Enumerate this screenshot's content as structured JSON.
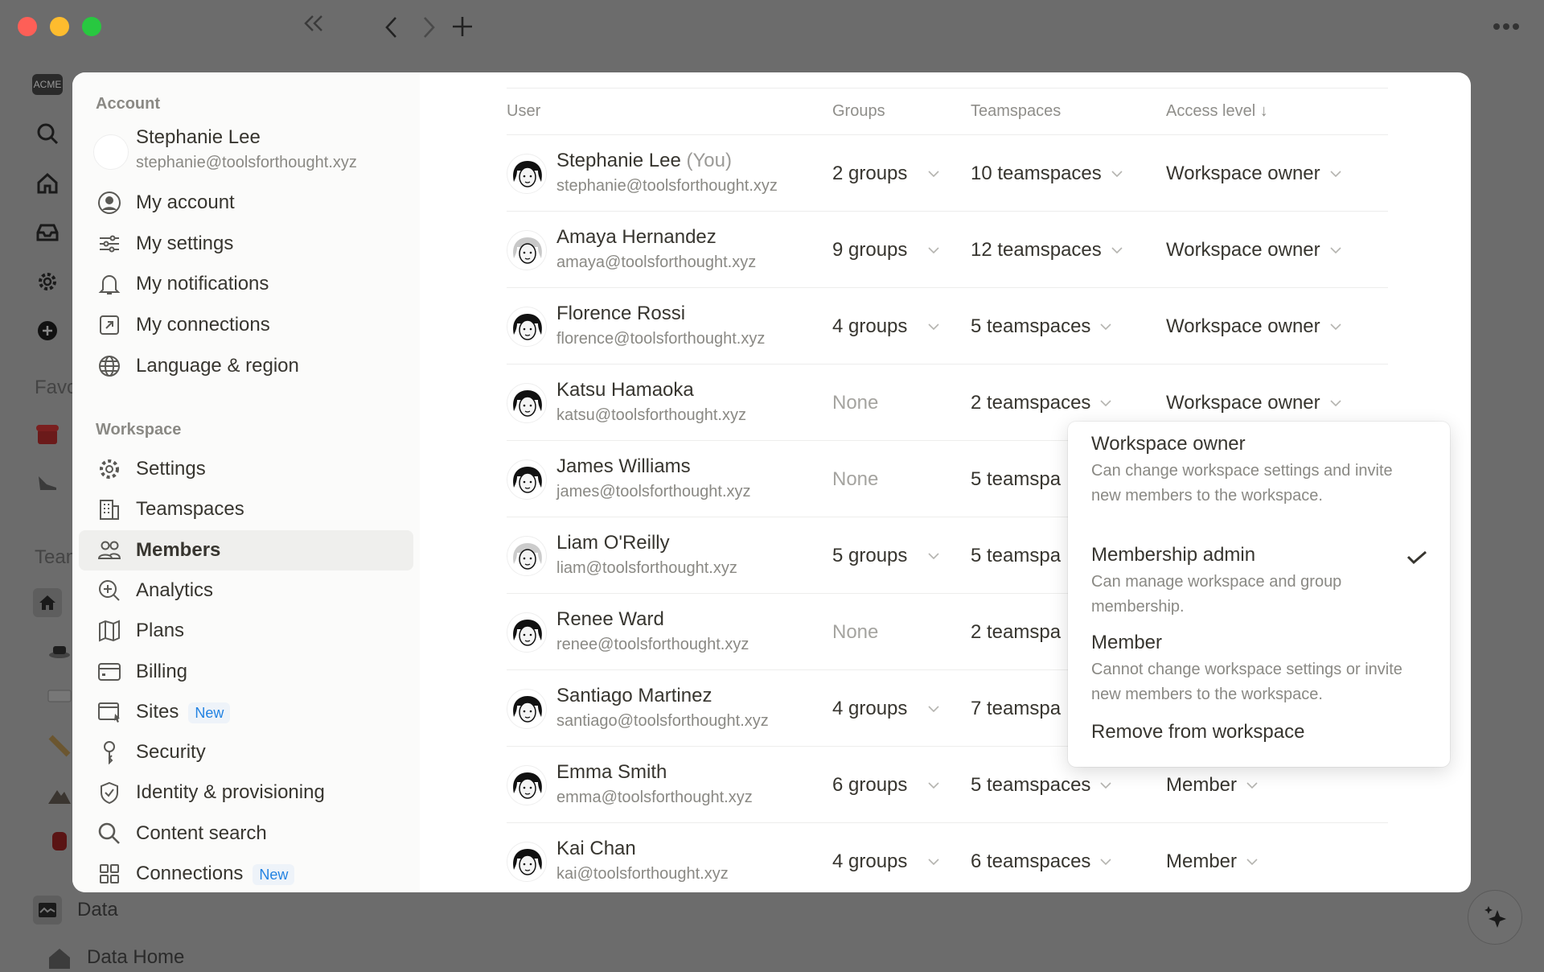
{
  "titlebar": {
    "colors": {
      "close": "#fe5f57",
      "minimize": "#febc2e",
      "zoom": "#28c840"
    }
  },
  "background": {
    "logo": "ACME",
    "favorites_label": "Favo",
    "teamspaces_label": "Tean",
    "data_label": "Data",
    "data_home_label": "Data Home"
  },
  "sidebar": {
    "account_label": "Account",
    "user": {
      "name": "Stephanie Lee",
      "email": "stephanie@toolsforthought.xyz"
    },
    "account_items": [
      {
        "label": "My account",
        "icon": "user-circle-icon"
      },
      {
        "label": "My settings",
        "icon": "sliders-icon"
      },
      {
        "label": "My notifications",
        "icon": "bell-icon"
      },
      {
        "label": "My connections",
        "icon": "external-link-icon"
      },
      {
        "label": "Language & region",
        "icon": "globe-icon"
      }
    ],
    "workspace_label": "Workspace",
    "workspace_items": [
      {
        "label": "Settings",
        "icon": "gear-icon"
      },
      {
        "label": "Teamspaces",
        "icon": "building-icon"
      },
      {
        "label": "Members",
        "icon": "people-icon",
        "active": true
      },
      {
        "label": "Analytics",
        "icon": "analytics-search-icon"
      },
      {
        "label": "Plans",
        "icon": "map-icon"
      },
      {
        "label": "Billing",
        "icon": "credit-card-icon"
      },
      {
        "label": "Sites",
        "icon": "browser-cursor-icon",
        "badge": "New"
      },
      {
        "label": "Security",
        "icon": "key-icon"
      },
      {
        "label": "Identity & provisioning",
        "icon": "shield-check-icon"
      },
      {
        "label": "Content search",
        "icon": "search-icon"
      },
      {
        "label": "Connections",
        "icon": "grid-icon",
        "badge": "New"
      }
    ]
  },
  "table": {
    "headers": {
      "user": "User",
      "groups": "Groups",
      "teamspaces": "Teamspaces",
      "access": "Access level ↓"
    },
    "rows": [
      {
        "name": "Stephanie Lee",
        "you": "(You)",
        "email": "stephanie@toolsforthought.xyz",
        "groups": "2 groups",
        "teamspaces": "10 teamspaces",
        "access": "Workspace owner"
      },
      {
        "name": "Amaya Hernandez",
        "email": "amaya@toolsforthought.xyz",
        "groups": "9 groups",
        "teamspaces": "12 teamspaces",
        "access": "Workspace owner"
      },
      {
        "name": "Florence Rossi",
        "email": "florence@toolsforthought.xyz",
        "groups": "4 groups",
        "teamspaces": "5 teamspaces",
        "access": "Workspace owner"
      },
      {
        "name": "Katsu Hamaoka",
        "email": "katsu@toolsforthought.xyz",
        "groups": "None",
        "teamspaces": "2 teamspaces",
        "access": "Workspace owner"
      },
      {
        "name": "James Williams",
        "email": "james@toolsforthought.xyz",
        "groups": "None",
        "teamspaces": "5 teamspa"
      },
      {
        "name": "Liam O'Reilly",
        "email": "liam@toolsforthought.xyz",
        "groups": "5 groups",
        "teamspaces": "5 teamspa"
      },
      {
        "name": "Renee Ward",
        "email": "renee@toolsforthought.xyz",
        "groups": "None",
        "teamspaces": "2 teamspa"
      },
      {
        "name": "Santiago Martinez",
        "email": "santiago@toolsforthought.xyz",
        "groups": "4 groups",
        "teamspaces": "7 teamspa"
      },
      {
        "name": "Emma Smith",
        "email": "emma@toolsforthought.xyz",
        "groups": "6 groups",
        "teamspaces": "5 teamspaces",
        "access": "Member"
      },
      {
        "name": "Kai Chan",
        "email": "kai@toolsforthought.xyz",
        "groups": "4 groups",
        "teamspaces": "6 teamspaces",
        "access": "Member"
      }
    ]
  },
  "access_dropdown": {
    "selected": "Workspace owner",
    "options": [
      {
        "title": "Workspace owner",
        "desc": "Can change workspace settings and invite new members to the workspace.",
        "checked": true
      },
      {
        "title": "Membership admin",
        "desc": "Can manage workspace and group membership."
      },
      {
        "title": "Member",
        "desc": "Cannot change workspace settings or invite new members to the workspace."
      }
    ],
    "remove_label": "Remove from workspace"
  }
}
